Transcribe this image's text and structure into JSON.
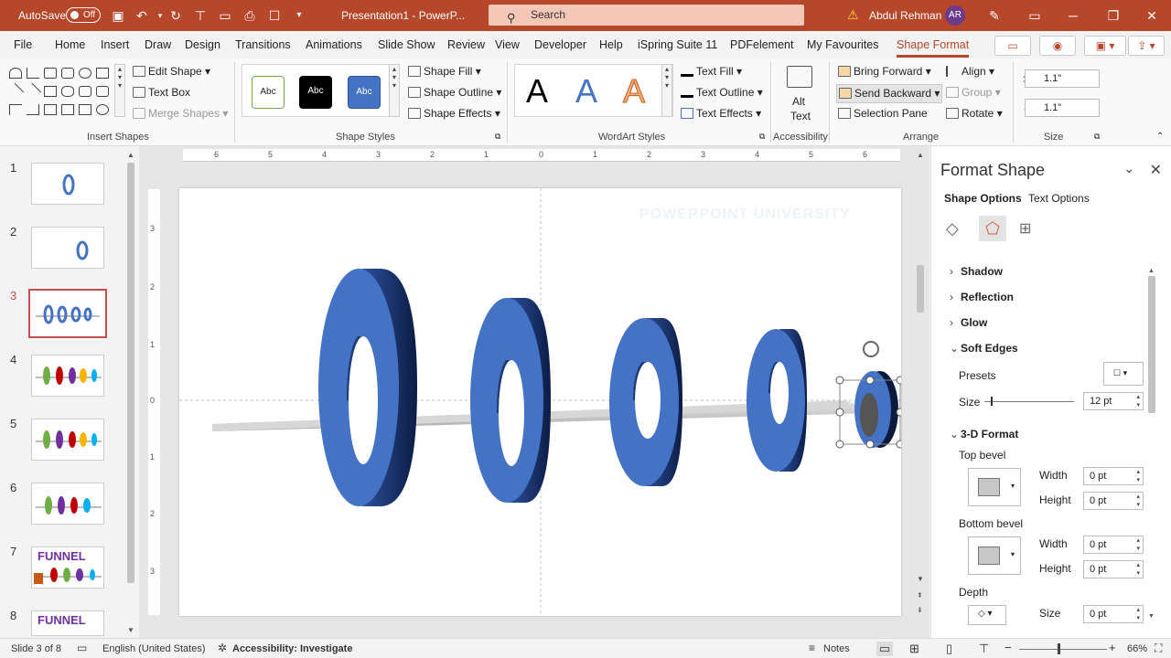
{
  "titlebar": {
    "autosave": "AutoSave",
    "toggle": "Off",
    "title": "Presentation1 - PowerP...",
    "search_placeholder": "Search",
    "user": "Abdul Rehman",
    "initials": "AR"
  },
  "menu": {
    "tabs": [
      "File",
      "Home",
      "Insert",
      "Draw",
      "Design",
      "Transitions",
      "Animations",
      "Slide Show",
      "Review",
      "View",
      "Developer",
      "Help",
      "iSpring Suite 11",
      "PDFelement",
      "My Favourites",
      "Shape Format"
    ]
  },
  "ribbon": {
    "insert_shapes": {
      "label": "Insert Shapes",
      "edit_shape": "Edit Shape",
      "text_box": "Text Box",
      "merge_shapes": "Merge Shapes"
    },
    "shape_styles": {
      "label": "Shape Styles",
      "styles": [
        "Abc",
        "Abc",
        "Abc"
      ],
      "shape_fill": "Shape Fill",
      "shape_outline": "Shape Outline",
      "shape_effects": "Shape Effects"
    },
    "wordart": {
      "label": "WordArt Styles",
      "letters": [
        "A",
        "A",
        "A"
      ],
      "text_fill": "Text Fill",
      "text_outline": "Text Outline",
      "text_effects": "Text Effects"
    },
    "accessibility": {
      "label": "Accessibility",
      "alt_text_1": "Alt",
      "alt_text_2": "Text"
    },
    "arrange": {
      "label": "Arrange",
      "bring_forward": "Bring Forward",
      "send_backward": "Send Backward",
      "selection_pane": "Selection Pane",
      "align": "Align",
      "group": "Group",
      "rotate": "Rotate"
    },
    "size": {
      "label": "Size",
      "height": "1.1\"",
      "width": "1.1\""
    }
  },
  "thumbnails": [
    {
      "num": "1"
    },
    {
      "num": "2"
    },
    {
      "num": "3"
    },
    {
      "num": "4"
    },
    {
      "num": "5"
    },
    {
      "num": "6"
    },
    {
      "num": "7",
      "text": "FUNNEL"
    },
    {
      "num": "8",
      "text": "FUNNEL"
    }
  ],
  "ruler": {
    "h": [
      "6",
      "5",
      "4",
      "3",
      "2",
      "1",
      "0",
      "1",
      "2",
      "3",
      "4",
      "5",
      "6"
    ],
    "v": [
      "3",
      "2",
      "1",
      "0",
      "1",
      "2",
      "3"
    ]
  },
  "slide": {
    "watermark": "POWERPOINT UNIVERSITY"
  },
  "format_pane": {
    "title": "Format Shape",
    "tabs": [
      "Shape Options",
      "Text Options"
    ],
    "sections": {
      "shadow": "Shadow",
      "reflection": "Reflection",
      "glow": "Glow",
      "soft_edges": "Soft Edges",
      "three_d": "3-D Format"
    },
    "presets_label": "Presets",
    "size_label": "Size",
    "size_value": "12 pt",
    "top_bevel": "Top bevel",
    "bottom_bevel": "Bottom bevel",
    "width_label": "Width",
    "height_label": "Height",
    "top_width": "0 pt",
    "top_height": "0 pt",
    "bottom_width": "0 pt",
    "bottom_height": "0 pt",
    "depth_label": "Depth",
    "depth_size_label": "Size",
    "depth_size": "0 pt"
  },
  "status": {
    "slide": "Slide 3 of 8",
    "language": "English (United States)",
    "accessibility": "Accessibility: Investigate",
    "notes": "Notes",
    "zoom": "66%"
  },
  "colors": {
    "accent": "#b7472a",
    "ring": "#4472c4"
  }
}
